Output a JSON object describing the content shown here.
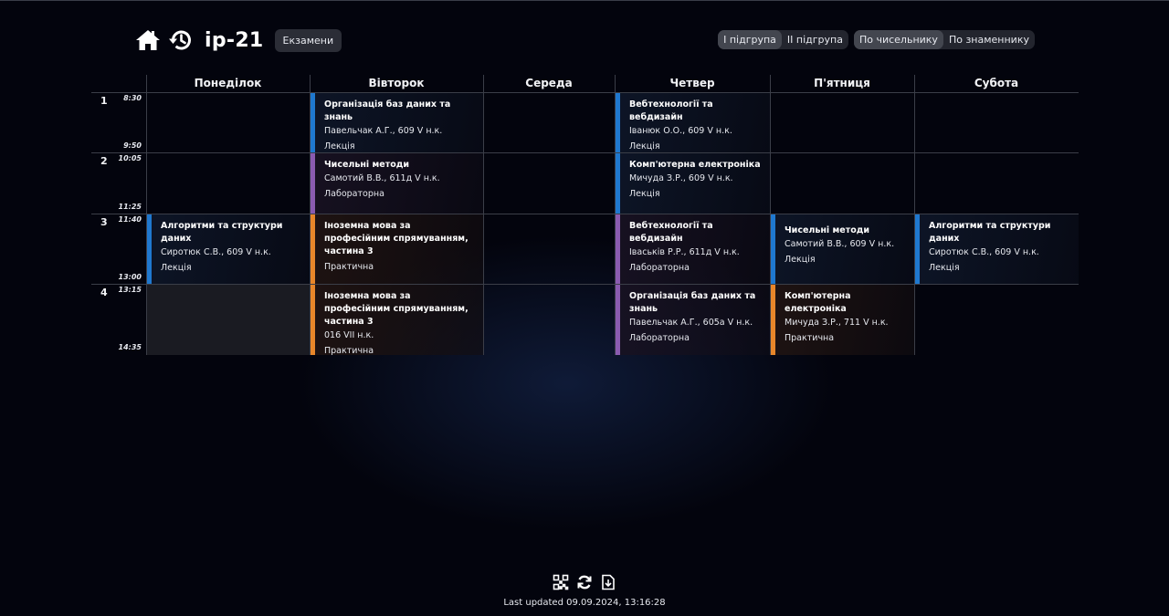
{
  "header": {
    "group": "ip-21",
    "exams_label": "Екзамени",
    "icons": [
      "home-icon",
      "history-icon"
    ]
  },
  "subgroup_toggle": {
    "options": [
      "I підгрупа",
      "II підгрупа"
    ],
    "selected": "I підгрупа"
  },
  "week_toggle": {
    "options": [
      "По чисельнику",
      "По знаменнику"
    ],
    "selected": "По чисельнику"
  },
  "days": [
    "Понеділок",
    "Вівторок",
    "Середа",
    "Четвер",
    "П'ятниця",
    "Субота"
  ],
  "slots": [
    {
      "num": "1",
      "start": "8:30",
      "end": "9:50"
    },
    {
      "num": "2",
      "start": "10:05",
      "end": "11:25"
    },
    {
      "num": "3",
      "start": "11:40",
      "end": "13:00"
    },
    {
      "num": "4",
      "start": "13:15",
      "end": "14:35"
    }
  ],
  "lessons": [
    {
      "subject": "Організація баз даних та знань",
      "teacher": "Павельчак А.Г., 609 V н.к.",
      "kind": "Лекція"
    },
    {
      "subject": "Вебтехнології та вебдизайн",
      "teacher": "Іванюк О.О., 609 V н.к.",
      "kind": "Лекція"
    },
    {
      "subject": "Чисельні методи",
      "teacher": "Самотий В.В., 611д V н.к.",
      "kind": "Лабораторна"
    },
    {
      "subject": "Комп'ютерна електроніка",
      "teacher": "Мичуда З.Р., 609 V н.к.",
      "kind": "Лекція"
    },
    {
      "subject": "Алгоритми та структури даних",
      "teacher": "Сиротюк С.В., 609 V н.к.",
      "kind": "Лекція"
    },
    {
      "subject": "Іноземна мова за професійним спрямуванням, частина 3",
      "teacher": "",
      "kind": "Практична"
    },
    {
      "subject": "Вебтехнології та вебдизайн",
      "teacher": "Іваськів Р.Р., 611д V н.к.",
      "kind": "Лабораторна"
    },
    {
      "subject": "Чисельні методи",
      "teacher": "Самотий В.В., 609 V н.к.",
      "kind": "Лекція"
    },
    {
      "subject": "Алгоритми та структури даних",
      "teacher": "Сиротюк С.В., 609 V н.к.",
      "kind": "Лекція"
    },
    {
      "subject": "Іноземна мова за професійним спрямуванням, частина 3",
      "teacher": "016 VII н.к.",
      "kind": "Практична"
    },
    {
      "subject": "Організація баз даних та знань",
      "teacher": "Павельчак А.Г., 605а V н.к.",
      "kind": "Лабораторна"
    },
    {
      "subject": "Комп'ютерна електроніка",
      "teacher": "Мичуда З.Р., 711 V н.к.",
      "kind": "Практична"
    }
  ],
  "colors": {
    "lecture": "#1f78cf",
    "lab": "#8a5bb0",
    "practice": "#e8862a",
    "background": "#03040d"
  },
  "footer": {
    "icons": [
      "qr-code-icon",
      "refresh-icon",
      "download-file-icon"
    ],
    "last_updated": "Last updated 09.09.2024, 13:16:28"
  }
}
